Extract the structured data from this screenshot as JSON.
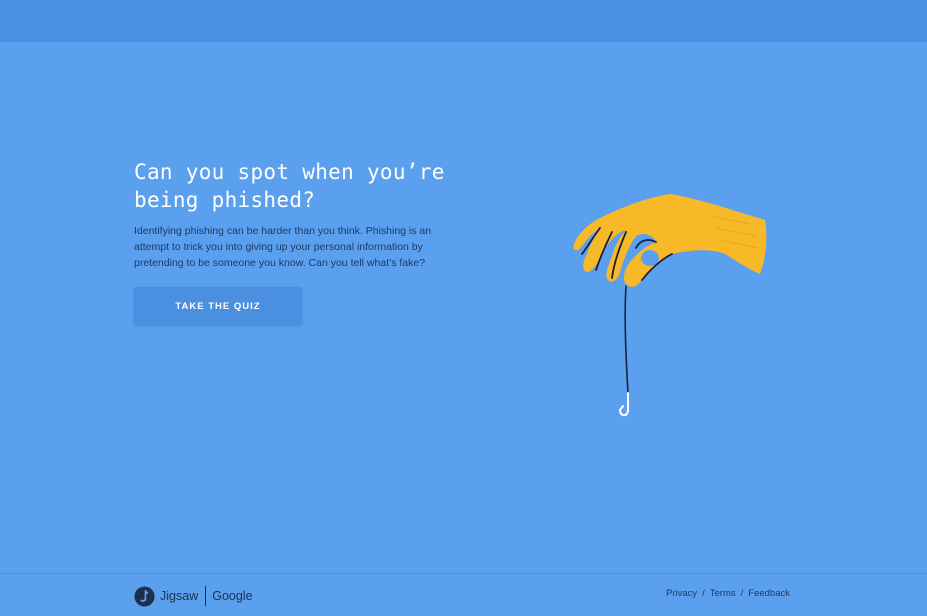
{
  "hero": {
    "title": "Can you spot when you’re being phished?",
    "description": "Identifying phishing can be harder than you think. Phishing is an attempt to trick you into giving up your personal information by pretending to be someone you know. Can you tell what’s fake?",
    "button_label": "TAKE THE QUIZ"
  },
  "illustration": {
    "icon": "hand-holding-fishhook-icon"
  },
  "footer": {
    "brand_primary": "Jigsaw",
    "brand_secondary": "Google",
    "links": {
      "privacy": "Privacy",
      "terms": "Terms",
      "feedback": "Feedback"
    },
    "separator": "/"
  },
  "colors": {
    "background": "#5aa0ee",
    "topbar": "#4a8fe0",
    "button": "#4a8fe0",
    "hand": "#f7b928",
    "text_dark": "#1d2f4d"
  }
}
